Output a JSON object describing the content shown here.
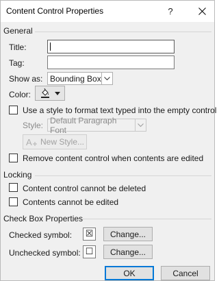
{
  "window": {
    "title": "Content Control Properties",
    "help_glyph": "?",
    "close_icon": "close-icon"
  },
  "general": {
    "heading": "General",
    "title_label": "Title:",
    "title_value": "",
    "tag_label": "Tag:",
    "tag_value": "",
    "show_as_label": "Show as:",
    "show_as_value": "Bounding Box",
    "color_label": "Color:",
    "color_icon": "paint-bucket-icon",
    "use_style_label": "Use a style to format text typed into the empty control",
    "use_style_checked": false,
    "style_label": "Style:",
    "style_value": "Default Paragraph Font",
    "new_style_label": "New Style...",
    "remove_label": "Remove content control when contents are edited",
    "remove_checked": false
  },
  "locking": {
    "heading": "Locking",
    "cannot_delete_label": "Content control cannot be deleted",
    "cannot_delete_checked": false,
    "cannot_edit_label": "Contents cannot be edited",
    "cannot_edit_checked": false
  },
  "checkbox_props": {
    "heading": "Check Box Properties",
    "checked_label": "Checked symbol:",
    "checked_symbol": "☒",
    "unchecked_label": "Unchecked symbol:",
    "unchecked_symbol": "☐",
    "change_label": "Change..."
  },
  "footer": {
    "ok_label": "OK",
    "cancel_label": "Cancel"
  },
  "colors": {
    "accent": "#0078d7",
    "dialog_bg": "#f0f0f0"
  }
}
